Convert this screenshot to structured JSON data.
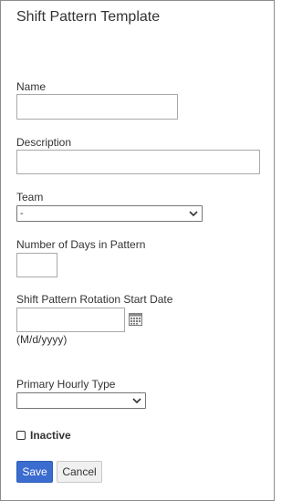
{
  "page": {
    "title": "Shift Pattern Template"
  },
  "form": {
    "name": {
      "label": "Name",
      "value": "",
      "placeholder": ""
    },
    "description": {
      "label": "Description",
      "value": "",
      "placeholder": ""
    },
    "team": {
      "label": "Team",
      "selected": "-"
    },
    "days_in_pattern": {
      "label": "Number of Days in Pattern",
      "value": ""
    },
    "rotation_start_date": {
      "label": "Shift Pattern Rotation Start Date",
      "value": "",
      "format_hint": "(M/d/yyyy)",
      "icon": "calendar-icon"
    },
    "primary_hourly_type": {
      "label": "Primary Hourly Type",
      "selected": ""
    },
    "inactive": {
      "label": "Inactive",
      "checked": false
    }
  },
  "actions": {
    "save_label": "Save",
    "cancel_label": "Cancel"
  },
  "colors": {
    "primary_button": "#3b6ccf",
    "text": "#333333",
    "border": "#a9a9a9"
  }
}
